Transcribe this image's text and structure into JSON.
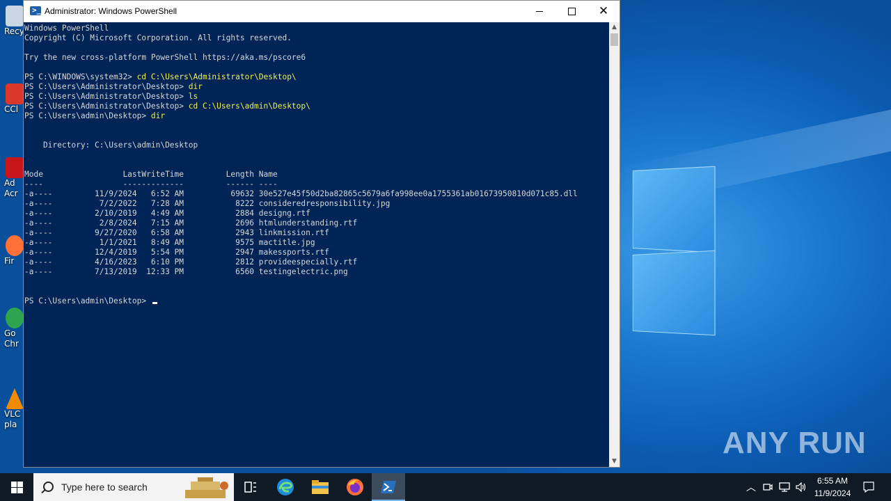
{
  "window": {
    "title": "Administrator: Windows PowerShell",
    "minimize_icon": "minimize-icon",
    "maximize_icon": "maximize-icon",
    "close_icon": "close-icon"
  },
  "console": {
    "lines": [
      {
        "prompt": "Windows PowerShell",
        "cmd": ""
      },
      {
        "prompt": "Copyright (C) Microsoft Corporation. All rights reserved.",
        "cmd": ""
      },
      {
        "prompt": "",
        "cmd": ""
      },
      {
        "prompt": "Try the new cross-platform PowerShell https://aka.ms/pscore6",
        "cmd": ""
      },
      {
        "prompt": "",
        "cmd": ""
      },
      {
        "prompt": "PS C:\\WINDOWS\\system32> ",
        "cmd": "cd C:\\Users\\Administrator\\Desktop\\"
      },
      {
        "prompt": "PS C:\\Users\\Administrator\\Desktop> ",
        "cmd": "dir"
      },
      {
        "prompt": "PS C:\\Users\\Administrator\\Desktop> ",
        "cmd": "ls"
      },
      {
        "prompt": "PS C:\\Users\\Administrator\\Desktop> ",
        "cmd": "cd C:\\Users\\admin\\Desktop\\"
      },
      {
        "prompt": "PS C:\\Users\\admin\\Desktop> ",
        "cmd": "dir"
      },
      {
        "prompt": "",
        "cmd": ""
      },
      {
        "prompt": "",
        "cmd": ""
      },
      {
        "prompt": "    Directory: C:\\Users\\admin\\Desktop",
        "cmd": ""
      },
      {
        "prompt": "",
        "cmd": ""
      },
      {
        "prompt": "",
        "cmd": ""
      },
      {
        "prompt": "Mode                 LastWriteTime         Length Name",
        "cmd": ""
      },
      {
        "prompt": "----                 -------------         ------ ----",
        "cmd": ""
      },
      {
        "prompt": "-a----         11/9/2024   6:52 AM          69632 30e527e45f50d2ba82865c5679a6fa998ee0a1755361ab01673950810d071c85.dll",
        "cmd": ""
      },
      {
        "prompt": "-a----          7/2/2022   7:28 AM           8222 consideredresponsibility.jpg",
        "cmd": ""
      },
      {
        "prompt": "-a----         2/10/2019   4:49 AM           2884 designg.rtf",
        "cmd": ""
      },
      {
        "prompt": "-a----          2/8/2024   7:15 AM           2696 htmlunderstanding.rtf",
        "cmd": ""
      },
      {
        "prompt": "-a----         9/27/2020   6:58 AM           2943 linkmission.rtf",
        "cmd": ""
      },
      {
        "prompt": "-a----          1/1/2021   8:49 AM           9575 mactitle.jpg",
        "cmd": ""
      },
      {
        "prompt": "-a----         12/4/2019   5:54 PM           2947 makessports.rtf",
        "cmd": ""
      },
      {
        "prompt": "-a----         4/16/2023   6:10 PM           2812 provideespecially.rtf",
        "cmd": ""
      },
      {
        "prompt": "-a----         7/13/2019  12:33 PM           6560 testingelectric.png",
        "cmd": ""
      },
      {
        "prompt": "",
        "cmd": ""
      },
      {
        "prompt": "",
        "cmd": ""
      },
      {
        "prompt": "PS C:\\Users\\admin\\Desktop> ",
        "cmd": "",
        "cursor": true
      }
    ]
  },
  "desktop": {
    "icons": [
      {
        "label": "Recy",
        "icon": "recycle-bin-icon",
        "color": "#c9d6e3"
      },
      {
        "label": "CCl",
        "icon": "ccleaner-icon",
        "color": "#d9382b"
      },
      {
        "label": "Ad\nAcr",
        "icon": "adobe-acrobat-icon",
        "color": "#c8151b"
      },
      {
        "label": "Fir",
        "icon": "firefox-icon",
        "color": "#ff7139"
      },
      {
        "label": "Go\nChr",
        "icon": "chrome-icon",
        "color": "#2ea44f"
      },
      {
        "label": "VLC\npla",
        "icon": "vlc-icon",
        "color": "#f08a00"
      }
    ],
    "watermark": "ANY RUN"
  },
  "taskbar": {
    "search_placeholder": "Type here to search",
    "clock_time": "6:55 AM",
    "clock_date": "11/9/2024",
    "pinned": [
      "task-view-icon",
      "edge-icon",
      "file-explorer-icon",
      "firefox-icon",
      "powershell-icon"
    ],
    "tray": [
      "chevron-up-icon",
      "meet-now-icon",
      "network-icon",
      "volume-icon"
    ]
  }
}
